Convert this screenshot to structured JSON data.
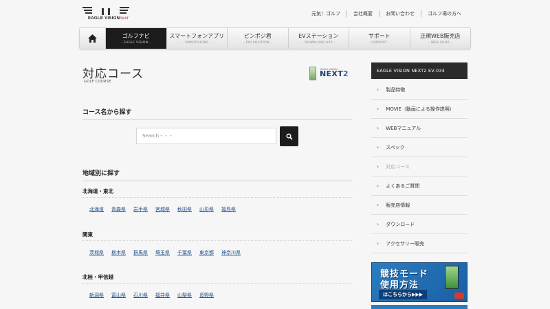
{
  "header": {
    "logo_text": "EAGLE VISION",
    "logo_accent": "next",
    "util_links": [
      "元気！ゴルフ",
      "会社概要",
      "お問い合わせ",
      "ゴルフ場の方へ"
    ]
  },
  "nav": {
    "items": [
      {
        "label": "ゴルフナビ",
        "sub": "- EAGLE VISION -",
        "active": true
      },
      {
        "label": "スマートフォンアプリ",
        "sub": "- SMARTPHONE -"
      },
      {
        "label": "ピンポジ君",
        "sub": "- PIN POSITION -"
      },
      {
        "label": "EVステーション",
        "sub": "- DOWNLOAD APP -"
      },
      {
        "label": "サポート",
        "sub": "- SUPPORT -"
      },
      {
        "label": "正規WEB販売店",
        "sub": "- WEB SHOP -"
      }
    ]
  },
  "main": {
    "title": "対応コース",
    "title_sub": "GOLF COURSE",
    "badge_small": "EAGLE VISION",
    "badge_big": "NEXT",
    "badge_num": "2",
    "search_heading": "コース名から探す",
    "search_placeholder": "Search・・・",
    "region_heading": "地域別に探す",
    "regions": [
      {
        "name": "北海道・東北",
        "prefs": [
          "北海道",
          "青森県",
          "岩手県",
          "宮城県",
          "秋田県",
          "山形県",
          "福島県"
        ]
      },
      {
        "name": "関東",
        "prefs": [
          "茨城県",
          "栃木県",
          "群馬県",
          "埼玉県",
          "千葉県",
          "東京都",
          "神奈川県"
        ]
      },
      {
        "name": "北陸・甲信越",
        "prefs": [
          "新潟県",
          "富山県",
          "石川県",
          "福井県",
          "山梨県",
          "長野県"
        ]
      }
    ]
  },
  "sidebar": {
    "heading": "EAGLE VISION NEXT2 EV-034",
    "items": [
      {
        "label": "製品特徴"
      },
      {
        "label": "MOVIE（動画による操作説明）"
      },
      {
        "label": "WEBマニュアル"
      },
      {
        "label": "スペック"
      },
      {
        "label": "対応コース",
        "current": true
      },
      {
        "label": "よくあるご質問"
      },
      {
        "label": "販売店情報"
      },
      {
        "label": "ダウンロード"
      },
      {
        "label": "アクセサリー販売"
      }
    ],
    "banner": {
      "line1": "競技モード",
      "line2": "使用方法",
      "line3": "はこちらから▶▶▶"
    }
  }
}
